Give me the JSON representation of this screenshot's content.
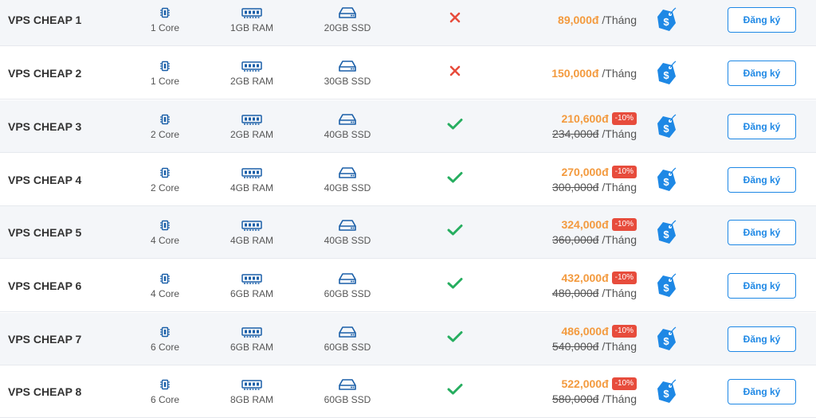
{
  "colors": {
    "accent": "#1e88e5",
    "price": "#f39a3e",
    "discount_badge": "#e74c3c",
    "check": "#27ae60",
    "cross": "#e74c3c"
  },
  "icons": {
    "core": "cpu-chip-icon",
    "ram": "ram-stick-icon",
    "ssd": "hard-drive-icon",
    "available": "check-icon",
    "unavailable": "cross-icon",
    "price_tag": "price-tag-icon"
  },
  "plans": [
    {
      "name": "VPS CHEAP 1",
      "core": "1 Core",
      "ram": "1GB RAM",
      "ssd": "20GB SSD",
      "feature": false,
      "price": "89,000đ",
      "unit": "/Tháng",
      "discount": "",
      "old_price": "",
      "button": "Đăng ký"
    },
    {
      "name": "VPS CHEAP 2",
      "core": "1 Core",
      "ram": "2GB RAM",
      "ssd": "30GB SSD",
      "feature": false,
      "price": "150,000đ",
      "unit": "/Tháng",
      "discount": "",
      "old_price": "",
      "button": "Đăng ký"
    },
    {
      "name": "VPS CHEAP 3",
      "core": "2 Core",
      "ram": "2GB RAM",
      "ssd": "40GB SSD",
      "feature": true,
      "price": "210,600đ",
      "unit": "/Tháng",
      "discount": "-10%",
      "old_price": "234,000đ",
      "button": "Đăng ký"
    },
    {
      "name": "VPS CHEAP 4",
      "core": "2 Core",
      "ram": "4GB RAM",
      "ssd": "40GB SSD",
      "feature": true,
      "price": "270,000đ",
      "unit": "/Tháng",
      "discount": "-10%",
      "old_price": "300,000đ",
      "button": "Đăng ký"
    },
    {
      "name": "VPS CHEAP 5",
      "core": "4 Core",
      "ram": "4GB RAM",
      "ssd": "40GB SSD",
      "feature": true,
      "price": "324,000đ",
      "unit": "/Tháng",
      "discount": "-10%",
      "old_price": "360,000đ",
      "button": "Đăng ký"
    },
    {
      "name": "VPS CHEAP 6",
      "core": "4 Core",
      "ram": "6GB RAM",
      "ssd": "60GB SSD",
      "feature": true,
      "price": "432,000đ",
      "unit": "/Tháng",
      "discount": "-10%",
      "old_price": "480,000đ",
      "button": "Đăng ký"
    },
    {
      "name": "VPS CHEAP 7",
      "core": "6 Core",
      "ram": "6GB RAM",
      "ssd": "60GB SSD",
      "feature": true,
      "price": "486,000đ",
      "unit": "/Tháng",
      "discount": "-10%",
      "old_price": "540,000đ",
      "button": "Đăng ký"
    },
    {
      "name": "VPS CHEAP 8",
      "core": "6 Core",
      "ram": "8GB RAM",
      "ssd": "60GB SSD",
      "feature": true,
      "price": "522,000đ",
      "unit": "/Tháng",
      "discount": "-10%",
      "old_price": "580,000đ",
      "button": "Đăng ký"
    }
  ]
}
